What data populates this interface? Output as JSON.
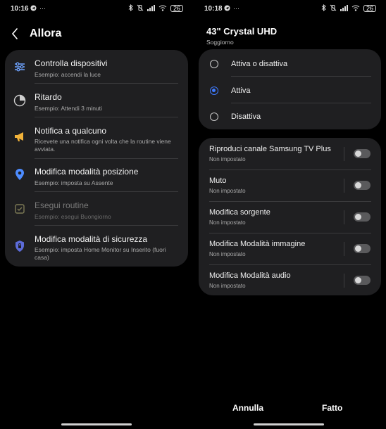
{
  "left": {
    "status": {
      "time": "10:16",
      "battery": "26"
    },
    "header": {
      "title": "Allora"
    },
    "actions": [
      {
        "title": "Controlla dispositivi",
        "sub": "Esempio: accendi la luce",
        "icon": "sliders-icon"
      },
      {
        "title": "Ritardo",
        "sub": "Esempio: Attendi 3 minuti",
        "icon": "clock-icon"
      },
      {
        "title": "Notifica a qualcuno",
        "sub": "Ricevete una notifica ogni volta che la routine viene avviata.",
        "icon": "megaphone-icon"
      },
      {
        "title": "Modifica modalità posizione",
        "sub": "Esempio: imposta su Assente",
        "icon": "location-pin-icon"
      },
      {
        "title": "Esegui routine",
        "sub": "Esempio: esegui Buongiorno",
        "icon": "routine-icon"
      },
      {
        "title": "Modifica modalità di sicurezza",
        "sub": "Esempio: imposta Home Monitor su Inserito (fuori casa)",
        "icon": "shield-icon"
      }
    ]
  },
  "right": {
    "status": {
      "time": "10:18",
      "battery": "26"
    },
    "device": {
      "title": "43\" Crystal UHD",
      "room": "Soggiorno"
    },
    "power_options": [
      {
        "label": "Attiva o disattiva",
        "selected": false
      },
      {
        "label": "Attiva",
        "selected": true
      },
      {
        "label": "Disattiva",
        "selected": false
      }
    ],
    "settings": [
      {
        "title": "Riproduci canale Samsung TV Plus",
        "sub": "Non impostato"
      },
      {
        "title": "Muto",
        "sub": "Non impostato"
      },
      {
        "title": "Modifica sorgente",
        "sub": "Non impostato"
      },
      {
        "title": "Modifica Modalità immagine",
        "sub": "Non impostato"
      },
      {
        "title": "Modifica Modalità audio",
        "sub": "Non impostato"
      }
    ],
    "footer": {
      "cancel": "Annulla",
      "done": "Fatto"
    }
  },
  "colors": {
    "accent": "#3f7bff",
    "card": "#1f1f21",
    "background": "#000000"
  }
}
